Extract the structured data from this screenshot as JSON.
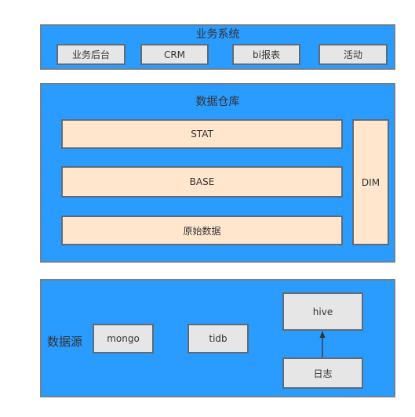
{
  "colors": {
    "panel_fill": "#2a9bff",
    "panel_border": "#6c8296",
    "gray_box": "#e6e6e6",
    "peach_box": "#ffe6cc",
    "box_border": "#5f6b76",
    "arrow": "#333333"
  },
  "business": {
    "title": "业务系统",
    "items": [
      "业务后台",
      "CRM",
      "bi报表",
      "活动"
    ]
  },
  "warehouse": {
    "title": "数据仓库",
    "layers": [
      "STAT",
      "BASE",
      "原始数据"
    ],
    "side": "DIM"
  },
  "sources": {
    "title": "数据源",
    "items": [
      "mongo",
      "tidb",
      "hive",
      "日志"
    ],
    "edges": [
      {
        "from": "日志",
        "to": "hive"
      }
    ]
  }
}
